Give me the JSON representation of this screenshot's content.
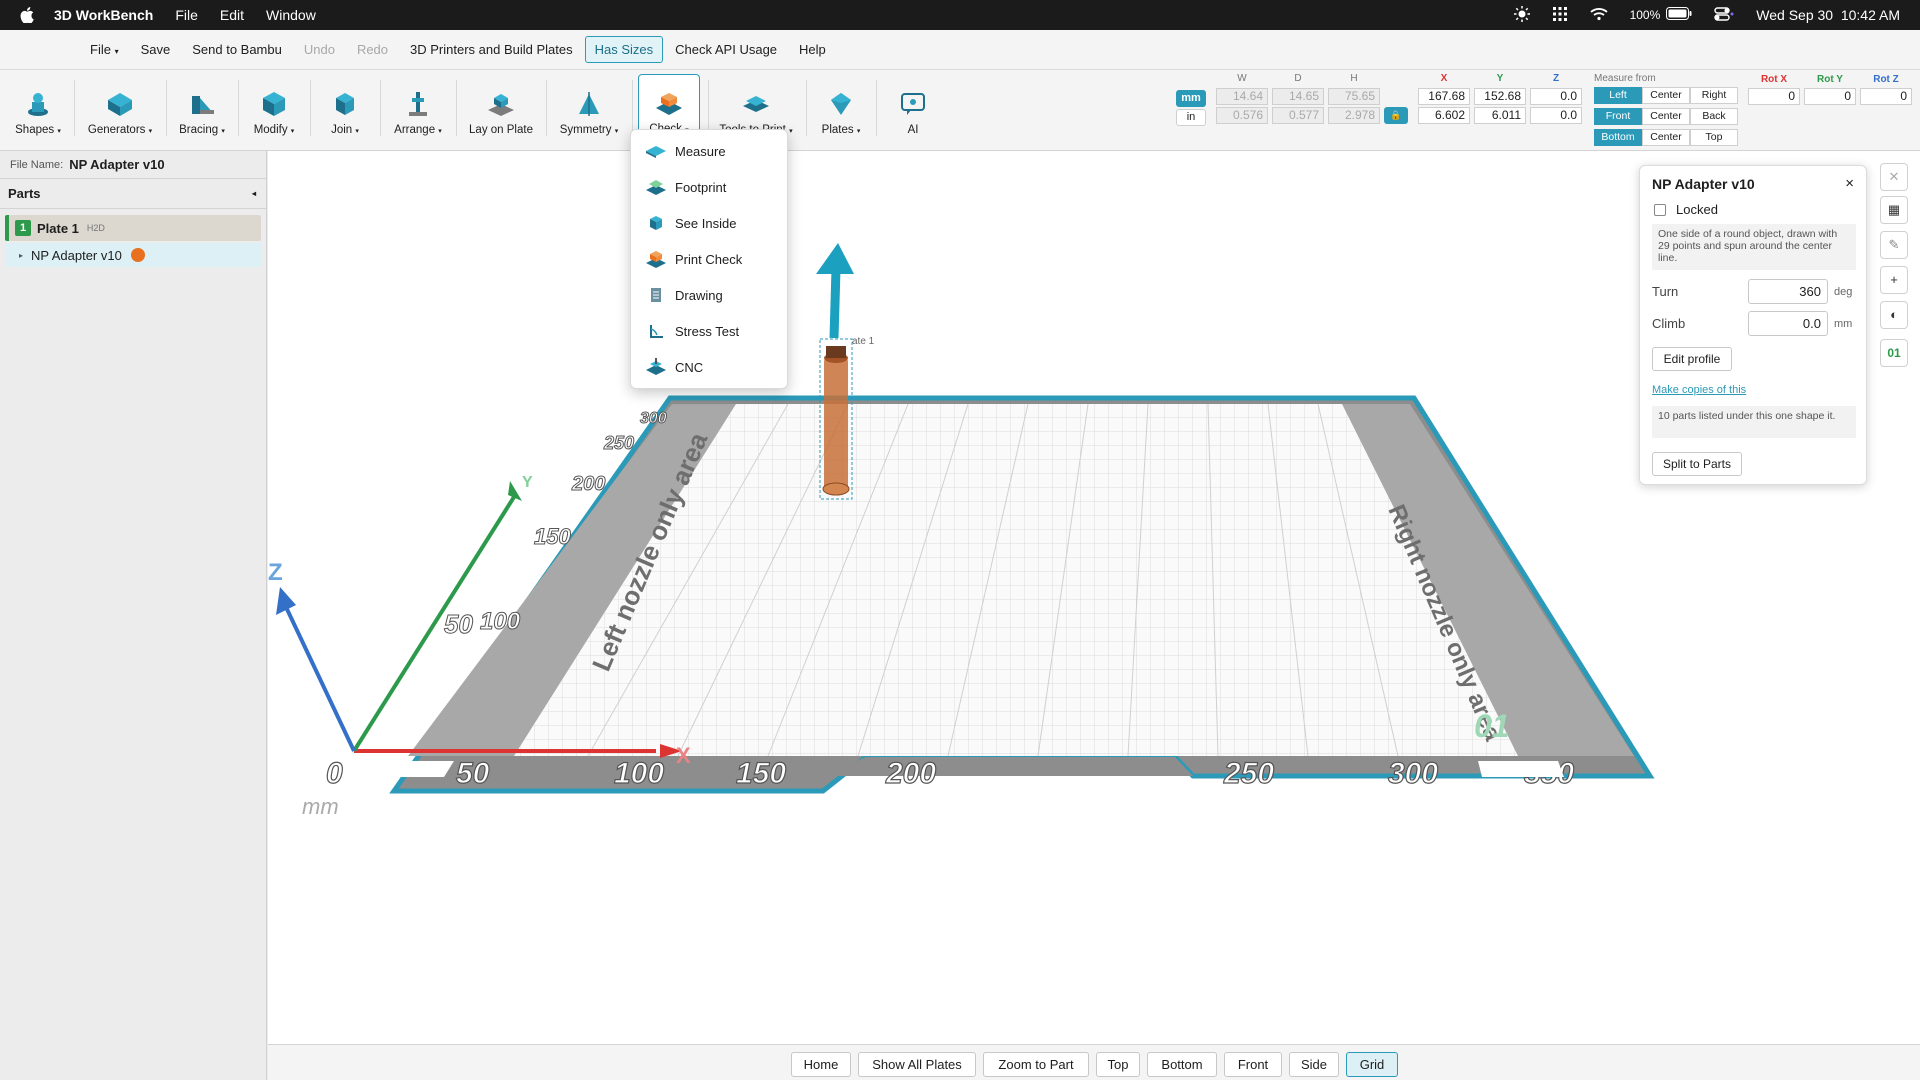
{
  "system_bar": {
    "app_name": "3D WorkBench",
    "menus": [
      "File",
      "Edit",
      "Window"
    ],
    "battery": "100%",
    "datetime": "Wed Sep 30  10:42 AM"
  },
  "menu": {
    "file": "File",
    "save": "Save",
    "send": "Send to Bambu",
    "undo": "Undo",
    "redo": "Redo",
    "printers": "3D Printers and Build Plates",
    "has_sizes": "Has Sizes",
    "check_api": "Check API Usage",
    "help": "Help"
  },
  "toolbar": {
    "shapes": "Shapes",
    "generators": "Generators",
    "bracing": "Bracing",
    "modify": "Modify",
    "join": "Join",
    "arrange": "Arrange",
    "lay_on_plate": "Lay on Plate",
    "symmetry": "Symmetry",
    "check": "Check",
    "tools_to_print": "Tools to Print",
    "plates": "Plates",
    "ai": "AI"
  },
  "dimensions": {
    "unit_mm": "mm",
    "unit_in": "in",
    "w_label": "W",
    "d_label": "D",
    "h_label": "H",
    "w_mm": "14.64",
    "d_mm": "14.65",
    "h_mm": "75.65",
    "w_in": "0.576",
    "d_in": "0.577",
    "h_in": "2.978",
    "x_label": "X",
    "y_label": "Y",
    "z_label": "Z",
    "x_mm": "167.68",
    "y_mm": "152.68",
    "z_mm": "0.0",
    "x_in": "6.602",
    "y_in": "6.011",
    "z_in": "0.0",
    "measure_from": "Measure from",
    "mf_left": "Left",
    "mf_center1": "Center",
    "mf_right": "Right",
    "mf_front": "Front",
    "mf_center2": "Center",
    "mf_back": "Back",
    "mf_bottom": "Bottom",
    "mf_center3": "Center",
    "mf_top": "Top",
    "rotx_label": "Rot X",
    "roty_label": "Rot Y",
    "rotz_label": "Rot Z",
    "rotx": "0",
    "roty": "0",
    "rotz": "0"
  },
  "left_panel": {
    "file_name_label": "File Name:",
    "file_name": "NP Adapter v10",
    "parts_title": "Parts",
    "plate_number": "1",
    "plate_name": "Plate 1",
    "plate_printer": "H2D",
    "part_name": "NP Adapter v10"
  },
  "check_menu": {
    "items": [
      "Measure",
      "Footprint",
      "See Inside",
      "Print Check",
      "Drawing",
      "Stress Test",
      "CNC"
    ]
  },
  "properties": {
    "title": "NP Adapter v10",
    "locked_label": "Locked",
    "description": "One side of a round object, drawn with 29 points and spun around the center line.",
    "turn_label": "Turn",
    "turn_value": "360",
    "turn_unit": "deg",
    "climb_label": "Climb",
    "climb_value": "0.0",
    "climb_unit": "mm",
    "edit_profile": "Edit profile",
    "make_copies": "Make copies of this",
    "parts_note": "10 parts listed under this one shape it.",
    "split_button": "Split to Parts"
  },
  "side_tools": {
    "plate_id": "01"
  },
  "viewport": {
    "left_zone": "Left nozzle only area",
    "right_zone": "Right nozzle only area",
    "x_ticks": [
      "0",
      "50",
      "100",
      "150",
      "200",
      "250",
      "300",
      "350"
    ],
    "y_ticks": [
      "50",
      "100",
      "150",
      "200",
      "250",
      "300"
    ],
    "unit_label": "mm",
    "axis_x": "X",
    "axis_y": "Y",
    "axis_z": "Z",
    "plate_badge": "01",
    "object_label": "ate 1"
  },
  "bottom_bar": {
    "home": "Home",
    "show_all": "Show All Plates",
    "zoom": "Zoom to Part",
    "top": "Top",
    "bottom": "Bottom",
    "front": "Front",
    "side": "Side",
    "grid": "Grid"
  },
  "colors": {
    "accent": "#2a9ab8",
    "part_orange": "#e8701e",
    "plate_green": "#2c9a4a"
  }
}
